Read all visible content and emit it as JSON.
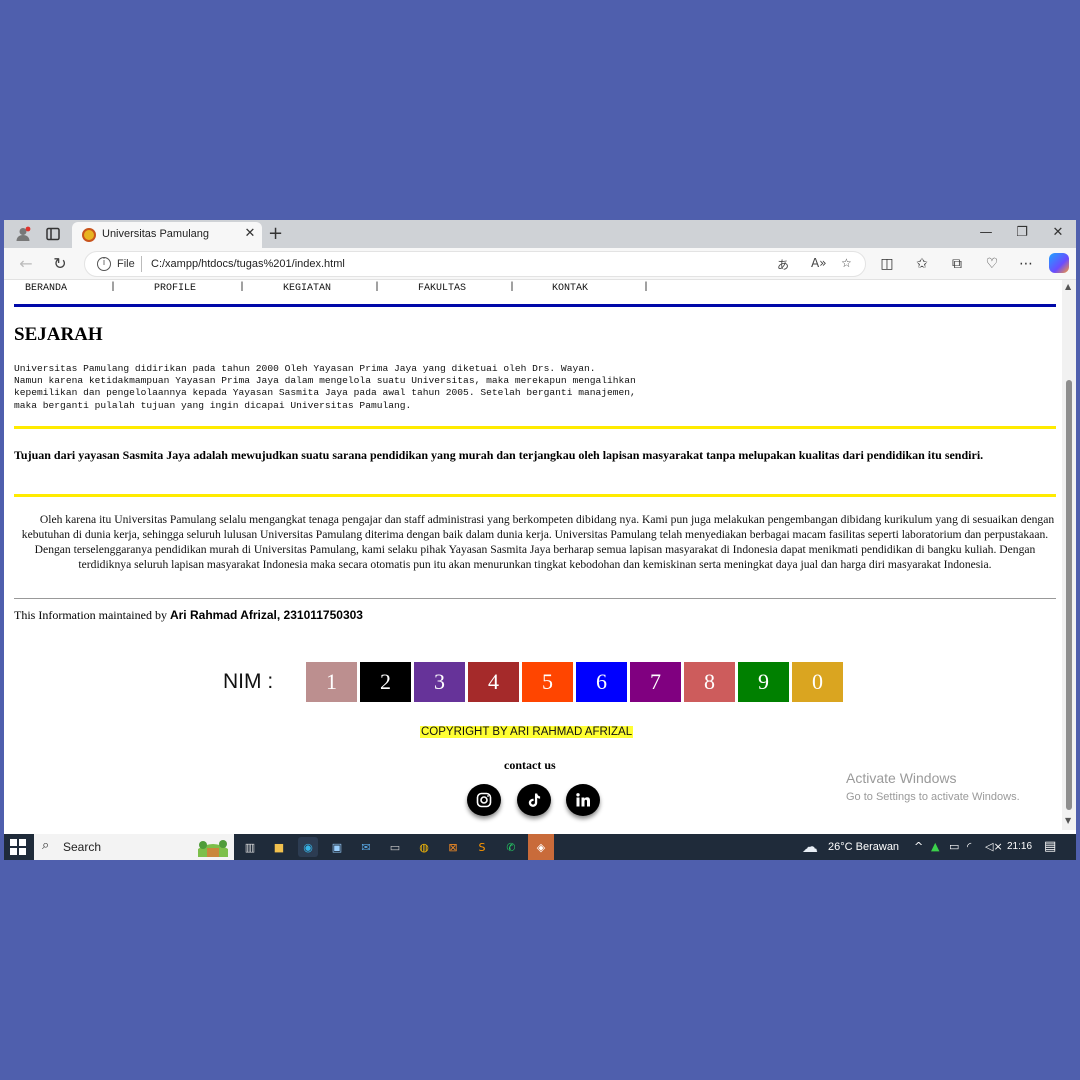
{
  "browser": {
    "tab_title": "Universitas Pamulang",
    "file_label": "File",
    "url": "C:/xampp/htdocs/tugas%201/index.html"
  },
  "nav": {
    "items": [
      "BERANDA",
      "PROFILE",
      "KEGIATAN",
      "FAKULTAS",
      "KONTAK"
    ],
    "separator": "|"
  },
  "content": {
    "heading": "SEJARAH",
    "history": "Universitas Pamulang didirikan pada tahun 2000 Oleh Yayasan Prima Jaya yang diketuai oleh Drs. Wayan.\nNamun karena ketidakmampuan Yayasan Prima Jaya dalam mengelola suatu Universitas, maka merekapun mengalihkan\nkepemilikan dan pengelolaannya kepada Yayasan Sasmita Jaya pada awal tahun 2005. Setelah berganti manajemen,\nmaka berganti pulalah tujuan yang ingin dicapai Universitas Pamulang.",
    "goal": "Tujuan dari yayasan Sasmita Jaya adalah mewujudkan suatu sarana pendidikan yang murah dan terjangkau oleh lapisan masyarakat tanpa melupakan kualitas dari pendidikan itu sendiri.",
    "paragraph": "Oleh karena itu Universitas Pamulang selalu mengangkat tenaga pengajar dan staff administrasi yang berkompeten dibidang nya. Kami pun juga melakukan pengembangan dibidang kurikulum yang di sesuaikan dengan kebutuhan di dunia kerja, sehingga seluruh lulusan Universitas Pamulang diterima dengan baik dalam dunia kerja. Universitas Pamulang telah menyediakan berbagai macam fasilitas seperti laboratorium dan perpustakaan. Dengan terselenggaranya pendidikan murah di Universitas Pamulang, kami selaku pihak Yayasan Sasmita Jaya berharap semua lapisan masyarakat di Indonesia dapat menikmati pendidikan di bangku kuliah. Dengan terdidiknya seluruh lapisan masyarakat Indonesia maka secara otomatis pun itu akan menurunkan tingkat kebodohan dan kemiskinan serta meningkat daya jual dan harga diri masyarakat Indonesia.",
    "maintained_prefix": "This Information maintained by ",
    "maintained_name": "Ari Rahmad Afrizal, 231011750303"
  },
  "nim": {
    "label": "NIM :",
    "digits": [
      "1",
      "2",
      "3",
      "4",
      "5",
      "6",
      "7",
      "8",
      "9",
      "0"
    ],
    "colors": [
      "#bc8f8f",
      "#000000",
      "#663399",
      "#a52a2a",
      "#ff4500",
      "#0000ff",
      "#800080",
      "#cd5c5c",
      "#008000",
      "#daa520"
    ]
  },
  "footer": {
    "copyright": "COPYRIGHT BY ARI RAHMAD AFRIZAL",
    "contact": "contact us",
    "social": [
      "instagram-icon",
      "tiktok-icon",
      "linkedin-icon"
    ]
  },
  "watermark": {
    "title": "Activate Windows",
    "subtitle": "Go to Settings to activate Windows."
  },
  "taskbar": {
    "search_label": "Search",
    "weather": "26°C  Berawan",
    "time": "21:16"
  }
}
